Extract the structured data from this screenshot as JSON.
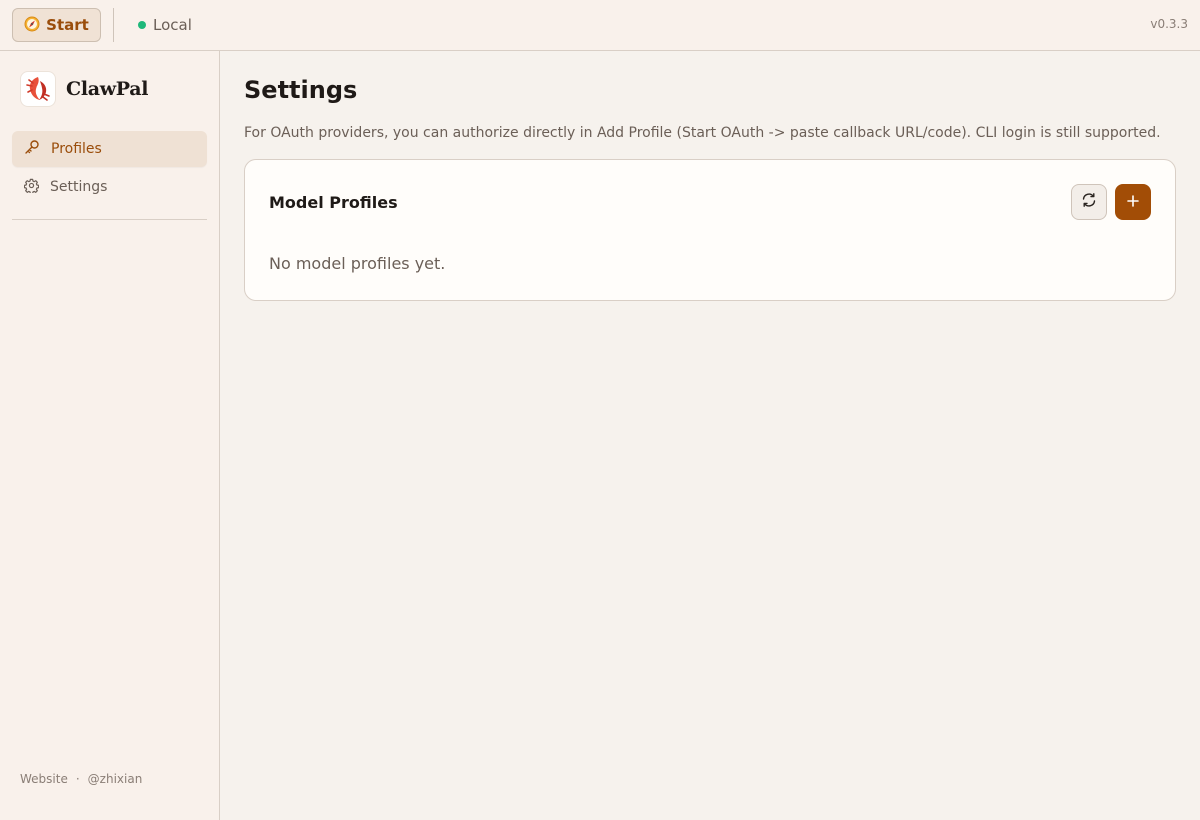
{
  "topbar": {
    "start_label": "Start",
    "instance_label": "Local",
    "instance_status_color": "#1fb87a",
    "version": "v0.3.3"
  },
  "sidebar": {
    "brand_name": "ClawPal",
    "items": [
      {
        "label": "Profiles",
        "icon": "key-icon",
        "active": true
      },
      {
        "label": "Settings",
        "icon": "gear-icon",
        "active": false
      }
    ],
    "footer": {
      "website_label": "Website",
      "separator": "·",
      "author_label": "@zhixian"
    }
  },
  "main": {
    "title": "Settings",
    "description": "For OAuth providers, you can authorize directly in Add Profile (Start OAuth -> paste callback URL/code). CLI login is still supported.",
    "card": {
      "title": "Model Profiles",
      "empty_text": "No model profiles yet."
    }
  },
  "colors": {
    "accent": "#a24d06",
    "accent_text": "#9a4d0b",
    "background": "#f6f2ed",
    "sidebar_background": "#f9f1eb"
  }
}
